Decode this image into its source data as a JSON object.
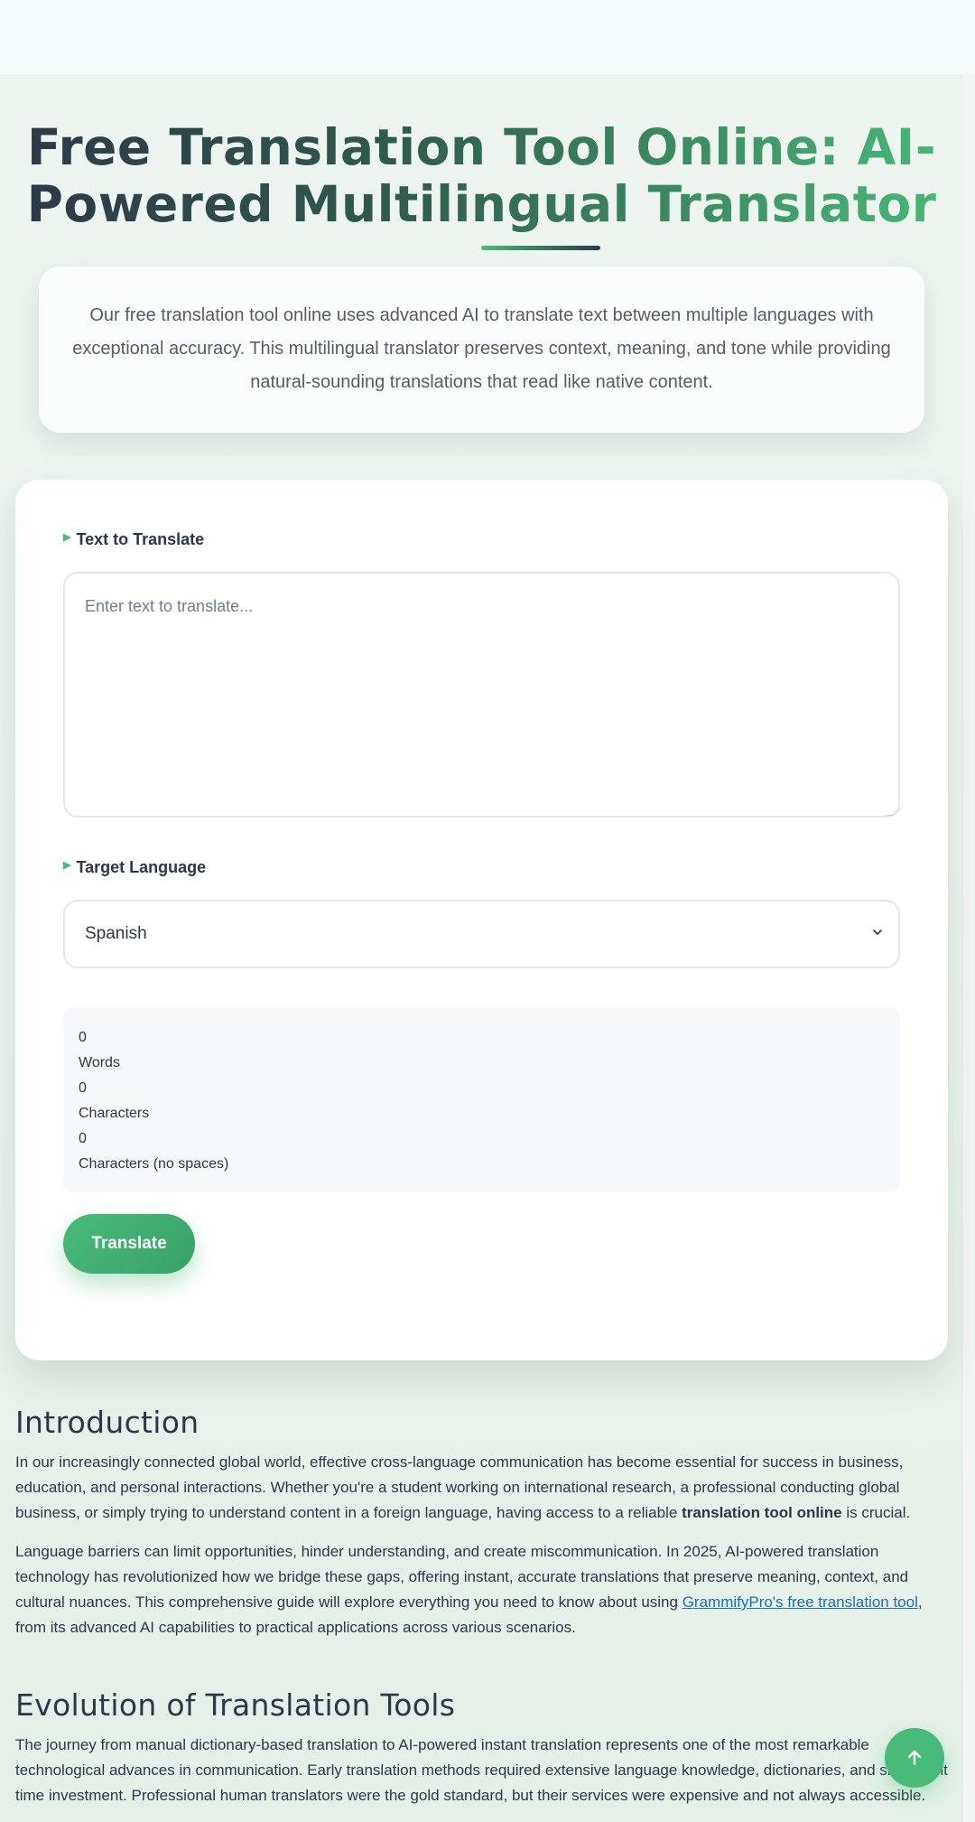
{
  "header": {
    "title": "Free Translation Tool Online: AI-Powered Multilingual Translator",
    "description": "Our free translation tool online uses advanced AI to translate text between multiple languages with exceptional accuracy. This multilingual translator preserves context, meaning, and tone while providing natural-sounding translations that read like native content."
  },
  "tool": {
    "text_label": "Text to Translate",
    "text_placeholder": "Enter text to translate...",
    "text_value": "",
    "language_label": "Target Language",
    "language_selected": "Spanish",
    "stats": {
      "words_count": "0",
      "words_label": "Words",
      "chars_count": "0",
      "chars_label": "Characters",
      "chars_nospace_count": "0",
      "chars_nospace_label": "Characters (no spaces)"
    },
    "translate_label": "Translate"
  },
  "article": {
    "intro_heading": "Introduction",
    "intro_p1_before": "In our increasingly connected global world, effective cross-language communication has become essential for success in business, education, and personal interactions. Whether you're a student working on international research, a professional conducting global business, or simply trying to understand content in a foreign language, having access to a reliable ",
    "intro_p1_bold": "translation tool online",
    "intro_p1_after": " is crucial.",
    "intro_p2_before": "Language barriers can limit opportunities, hinder understanding, and create miscommunication. In 2025, AI-powered translation technology has revolutionized how we bridge these gaps, offering instant, accurate translations that preserve meaning, context, and cultural nuances. This comprehensive guide will explore everything you need to know about using ",
    "intro_p2_link": "GrammifyPro's free translation tool",
    "intro_p2_after": ", from its advanced AI capabilities to practical applications across various scenarios.",
    "evolution_heading": "Evolution of Translation Tools",
    "evolution_p1": "The journey from manual dictionary-based translation to AI-powered instant translation represents one of the most remarkable technological advances in communication. Early translation methods required extensive language knowledge, dictionaries, and significant time investment. Professional human translators were the gold standard, but their services were expensive and not always accessible."
  },
  "icons": {
    "label_marker": "triangle-right-icon",
    "select_chevron": "chevron-down-icon",
    "scroll_top": "arrow-up-icon"
  },
  "colors": {
    "accent": "#48bb78",
    "text_dark": "#2d3748",
    "link": "#1a6fb5"
  }
}
